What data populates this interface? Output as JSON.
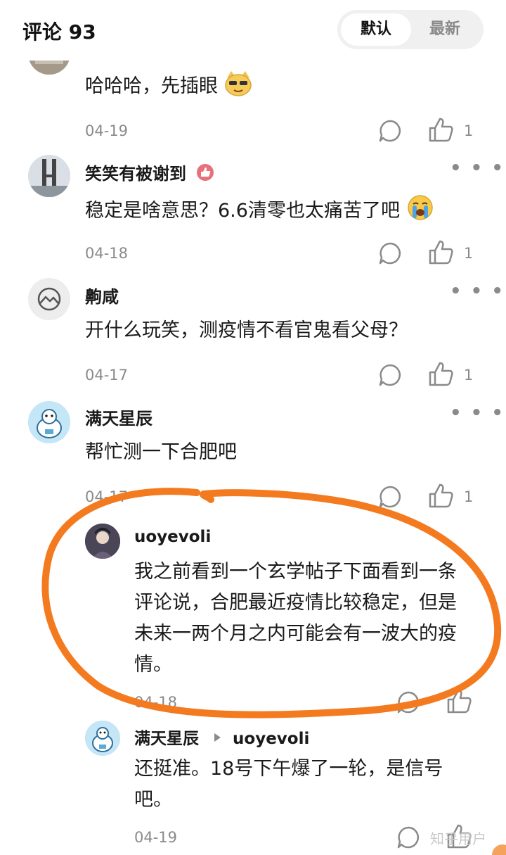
{
  "header": {
    "title": "评论 93",
    "sort_default": "默认",
    "sort_latest": "最新"
  },
  "comments": [
    {
      "author": "",
      "text": "哈哈哈，先插眼",
      "date": "04-19",
      "likes": "1",
      "emoji": "cat-face-emoji"
    },
    {
      "author": "笑笑有被谢到",
      "text": "稳定是啥意思？6.6清零也太痛苦了吧",
      "date": "04-18",
      "likes": "1",
      "badge": "thumb-badge-icon",
      "emoji": "crying-face-emoji"
    },
    {
      "author": "齁咸",
      "text": "开什么玩笑，测疫情不看官鬼看父母？",
      "date": "04-17",
      "likes": "1"
    },
    {
      "author": "满天星辰",
      "text": "帮忙测一下合肥吧",
      "date": "04-17",
      "likes": "1"
    }
  ],
  "replies": [
    {
      "author": "uoyevoli",
      "text_lines": [
        "我之前看到一个玄学帖子下面看到一条",
        "评论说，合肥最近疫情比较稳定，但是",
        "未来一两个月之内可能会有一波大的疫",
        "情。"
      ],
      "date": "04-18"
    },
    {
      "author": "满天星辰",
      "reply_to": "uoyevoli",
      "text_lines": [
        "还挺准。18号下午爆了一轮，是信号",
        "吧。"
      ],
      "date": "04-19"
    }
  ],
  "watermark": "知乎用户",
  "colors": {
    "annotation": "#f47a20",
    "muted": "#8a8a8a",
    "text": "#1a1a1a"
  }
}
